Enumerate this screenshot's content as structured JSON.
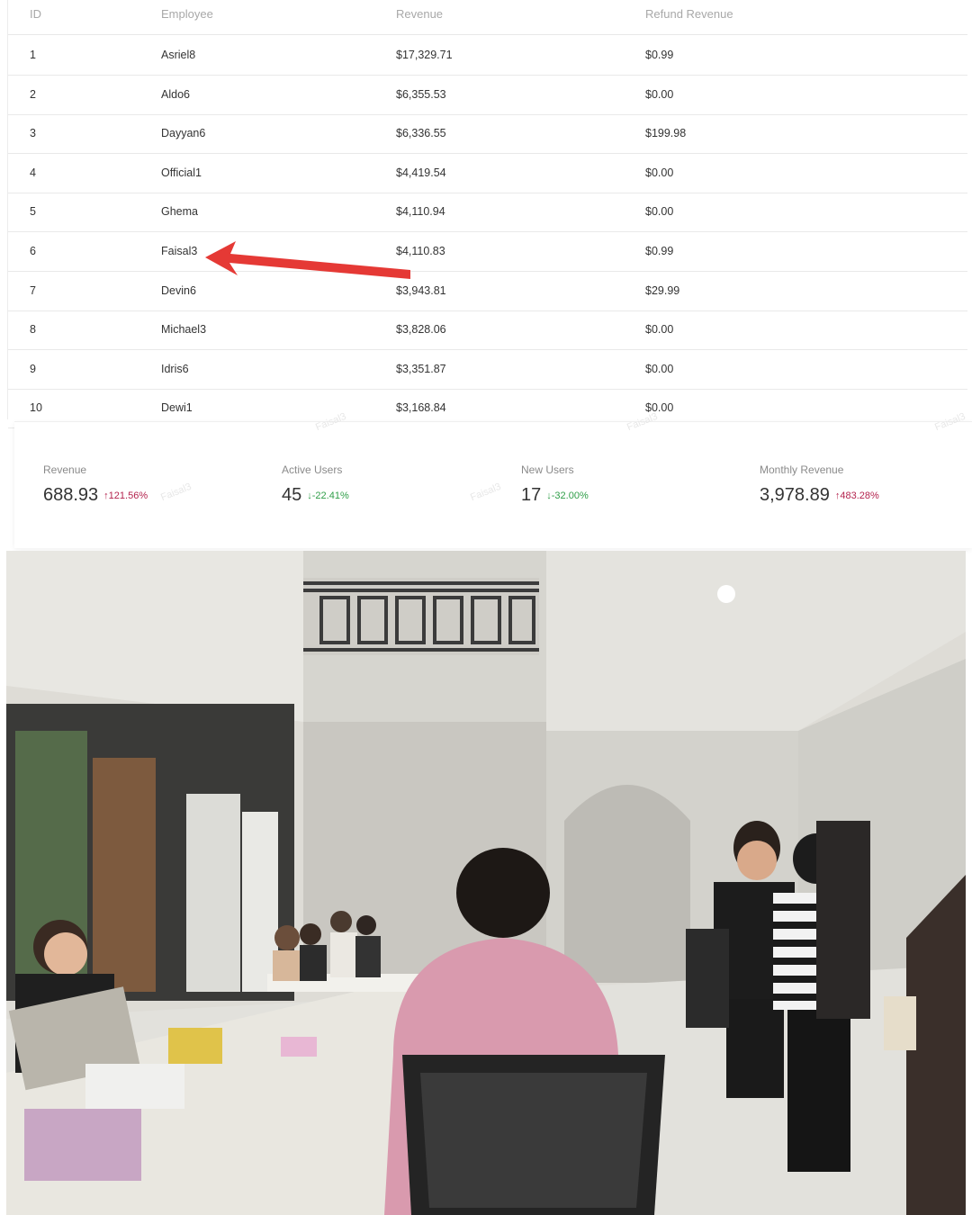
{
  "table": {
    "headers": {
      "id": "ID",
      "employee": "Employee",
      "revenue": "Revenue",
      "refund": "Refund Revenue"
    },
    "rows": [
      {
        "id": "1",
        "employee": "Asriel8",
        "revenue": "$17,329.71",
        "refund": "$0.99"
      },
      {
        "id": "2",
        "employee": "Aldo6",
        "revenue": "$6,355.53",
        "refund": "$0.00"
      },
      {
        "id": "3",
        "employee": "Dayyan6",
        "revenue": "$6,336.55",
        "refund": "$199.98"
      },
      {
        "id": "4",
        "employee": "Official1",
        "revenue": "$4,419.54",
        "refund": "$0.00"
      },
      {
        "id": "5",
        "employee": "Ghema",
        "revenue": "$4,110.94",
        "refund": "$0.00"
      },
      {
        "id": "6",
        "employee": "Faisal3",
        "revenue": "$4,110.83",
        "refund": "$0.99"
      },
      {
        "id": "7",
        "employee": "Devin6",
        "revenue": "$3,943.81",
        "refund": "$29.99"
      },
      {
        "id": "8",
        "employee": "Michael3",
        "revenue": "$3,828.06",
        "refund": "$0.00"
      },
      {
        "id": "9",
        "employee": "Idris6",
        "revenue": "$3,351.87",
        "refund": "$0.00"
      },
      {
        "id": "10",
        "employee": "Dewi1",
        "revenue": "$3,168.84",
        "refund": "$0.00"
      }
    ]
  },
  "annotation": {
    "highlighted_employee": "Faisal3",
    "arrow_color": "#e53935"
  },
  "metrics": [
    {
      "label": "Revenue",
      "value": "688.93",
      "change": "121.56%",
      "direction": "up"
    },
    {
      "label": "Active Users",
      "value": "45",
      "change": "-22.41%",
      "direction": "down"
    },
    {
      "label": "New Users",
      "value": "17",
      "change": "-32.00%",
      "direction": "down"
    },
    {
      "label": "Monthly Revenue",
      "value": "3,978.89",
      "change": "483.28%",
      "direction": "up"
    }
  ],
  "watermark": "Faisal3",
  "colors": {
    "up": "#b4234e",
    "down": "#2f9e48",
    "arrow": "#e53935"
  }
}
